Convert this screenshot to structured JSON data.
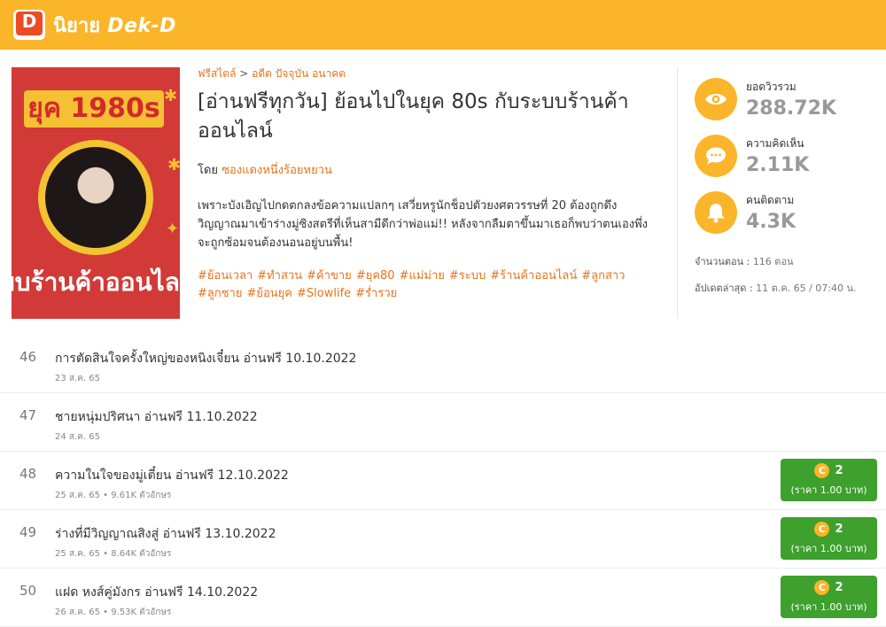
{
  "header": {
    "logo_letter": "D",
    "brand_thai": "นิยาย",
    "brand_latin": "Dek-D",
    "bg_color": "#fbb52a"
  },
  "cover": {
    "era_text": "ยุค 1980s",
    "banner_text": "บบร้านค้าออนไล"
  },
  "novel": {
    "breadcrumb_genre": "ฟรีสไตล์",
    "breadcrumb_separator": ">",
    "breadcrumb_sub": "อดีต ปัจจุบัน อนาคต",
    "title": "[อ่านฟรีทุกวัน] ย้อนไปในยุค 80s กับระบบร้านค้าออนไลน์",
    "author_prefix": "โดย",
    "author_name": "ซองแดงหนึ่งร้อยหยวน",
    "synopsis": "เพราะบังเอิญไปกดตกลงข้อความแปลกๆ เสวี่ยหรูนักช็อปตัวยงศตวรรษที่ 20 ต้องถูกดึงวิญญาณมาเข้าร่างมู่ซิงสตรีที่เห็นสามีดีกว่าพ่อแม่!! หลังจากลืมตาขึ้นมาเธอก็พบว่าตนเองพึ่งจะถูกซ้อมจนต้องนอนอยู่บนพื้น!",
    "tags": [
      "#ย้อนเวลา",
      "#ทำสวน",
      "#ค้าขาย",
      "#ยุค80",
      "#แม่ม่าย",
      "#ระบบ",
      "#ร้านค้าออนไลน์",
      "#ลูกสาว",
      "#ลูกชาย",
      "#ย้อนยุค",
      "#Slowlife",
      "#ร่ำรวย"
    ]
  },
  "stats": {
    "views": {
      "label": "ยอดวิวรวม",
      "value": "288.72K",
      "icon": "eye-icon"
    },
    "comments": {
      "label": "ความคิดเห็น",
      "value": "2.11K",
      "icon": "comment-icon"
    },
    "followers": {
      "label": "คนติดตาม",
      "value": "4.3K",
      "icon": "bell-icon"
    },
    "episodes_label": "จำนวนตอน :",
    "episodes_value": "116 ตอน",
    "updated_label": "อัปเดตล่าสุด :",
    "updated_value": "11 ต.ค. 65 / 07:40 น."
  },
  "chapters": [
    {
      "no": "46",
      "title": "การตัดสินใจครั้งใหญ่ของหนิงเจี๋ยน อ่านฟรี 10.10.2022",
      "meta": "23 ส.ค. 65",
      "paid": false
    },
    {
      "no": "47",
      "title": "ชายหนุ่มปริศนา อ่านฟรี 11.10.2022",
      "meta": "24 ส.ค. 65",
      "paid": false
    },
    {
      "no": "48",
      "title": "ความในใจของมู่เตี๋ยน อ่านฟรี 12.10.2022",
      "meta": "25 ส.ค. 65 • 9.61K ตัวอักษร",
      "paid": true,
      "coins": "2",
      "price": "(ราคา 1.00 บาท)"
    },
    {
      "no": "49",
      "title": "ร่างที่มีวิญญาณสิงสู่ อ่านฟรี 13.10.2022",
      "meta": "25 ส.ค. 65 • 8.64K ตัวอักษร",
      "paid": true,
      "coins": "2",
      "price": "(ราคา 1.00 บาท)"
    },
    {
      "no": "50",
      "title": "แฝด หงส์คู่มังกร อ่านฟรี 14.10.2022",
      "meta": "26 ส.ค. 65 • 9.53K ตัวอักษร",
      "paid": true,
      "coins": "2",
      "price": "(ราคา 1.00 บาท)"
    }
  ],
  "coin_symbol": "C"
}
